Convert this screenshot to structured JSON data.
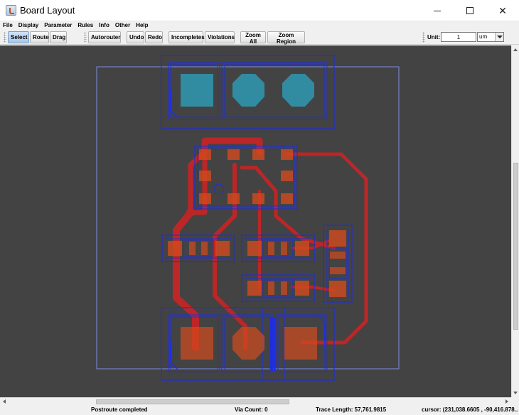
{
  "window": {
    "title": "Board Layout"
  },
  "menu": [
    "File",
    "Display",
    "Parameter",
    "Rules",
    "Info",
    "Other",
    "Help"
  ],
  "toolbar": {
    "select": "Select",
    "route": "Route",
    "drag": "Drag",
    "autorouter": "Autorouter",
    "undo": "Undo",
    "redo": "Redo",
    "incompletes": "Incompletes",
    "violations": "Violations",
    "zoom_all": "Zoom All",
    "zoom_region": "Zoom Region",
    "unit_label": "Unit:",
    "unit_value": "1",
    "unit_type": "um"
  },
  "status": {
    "message": "Postroute completed",
    "via_count": "Via Count: 0",
    "trace_length": "Trace Length: 57,761.9815",
    "cursor": "cursor:  (231,038.6605 , -90,416.878..."
  },
  "colors": {
    "background": "#434343",
    "outline": "#1f2fd8",
    "board_outline": "#7b8fe0",
    "trace": "#d22222",
    "pad_top": "#d24a1e",
    "pad_bottom": "#2e98b2"
  }
}
